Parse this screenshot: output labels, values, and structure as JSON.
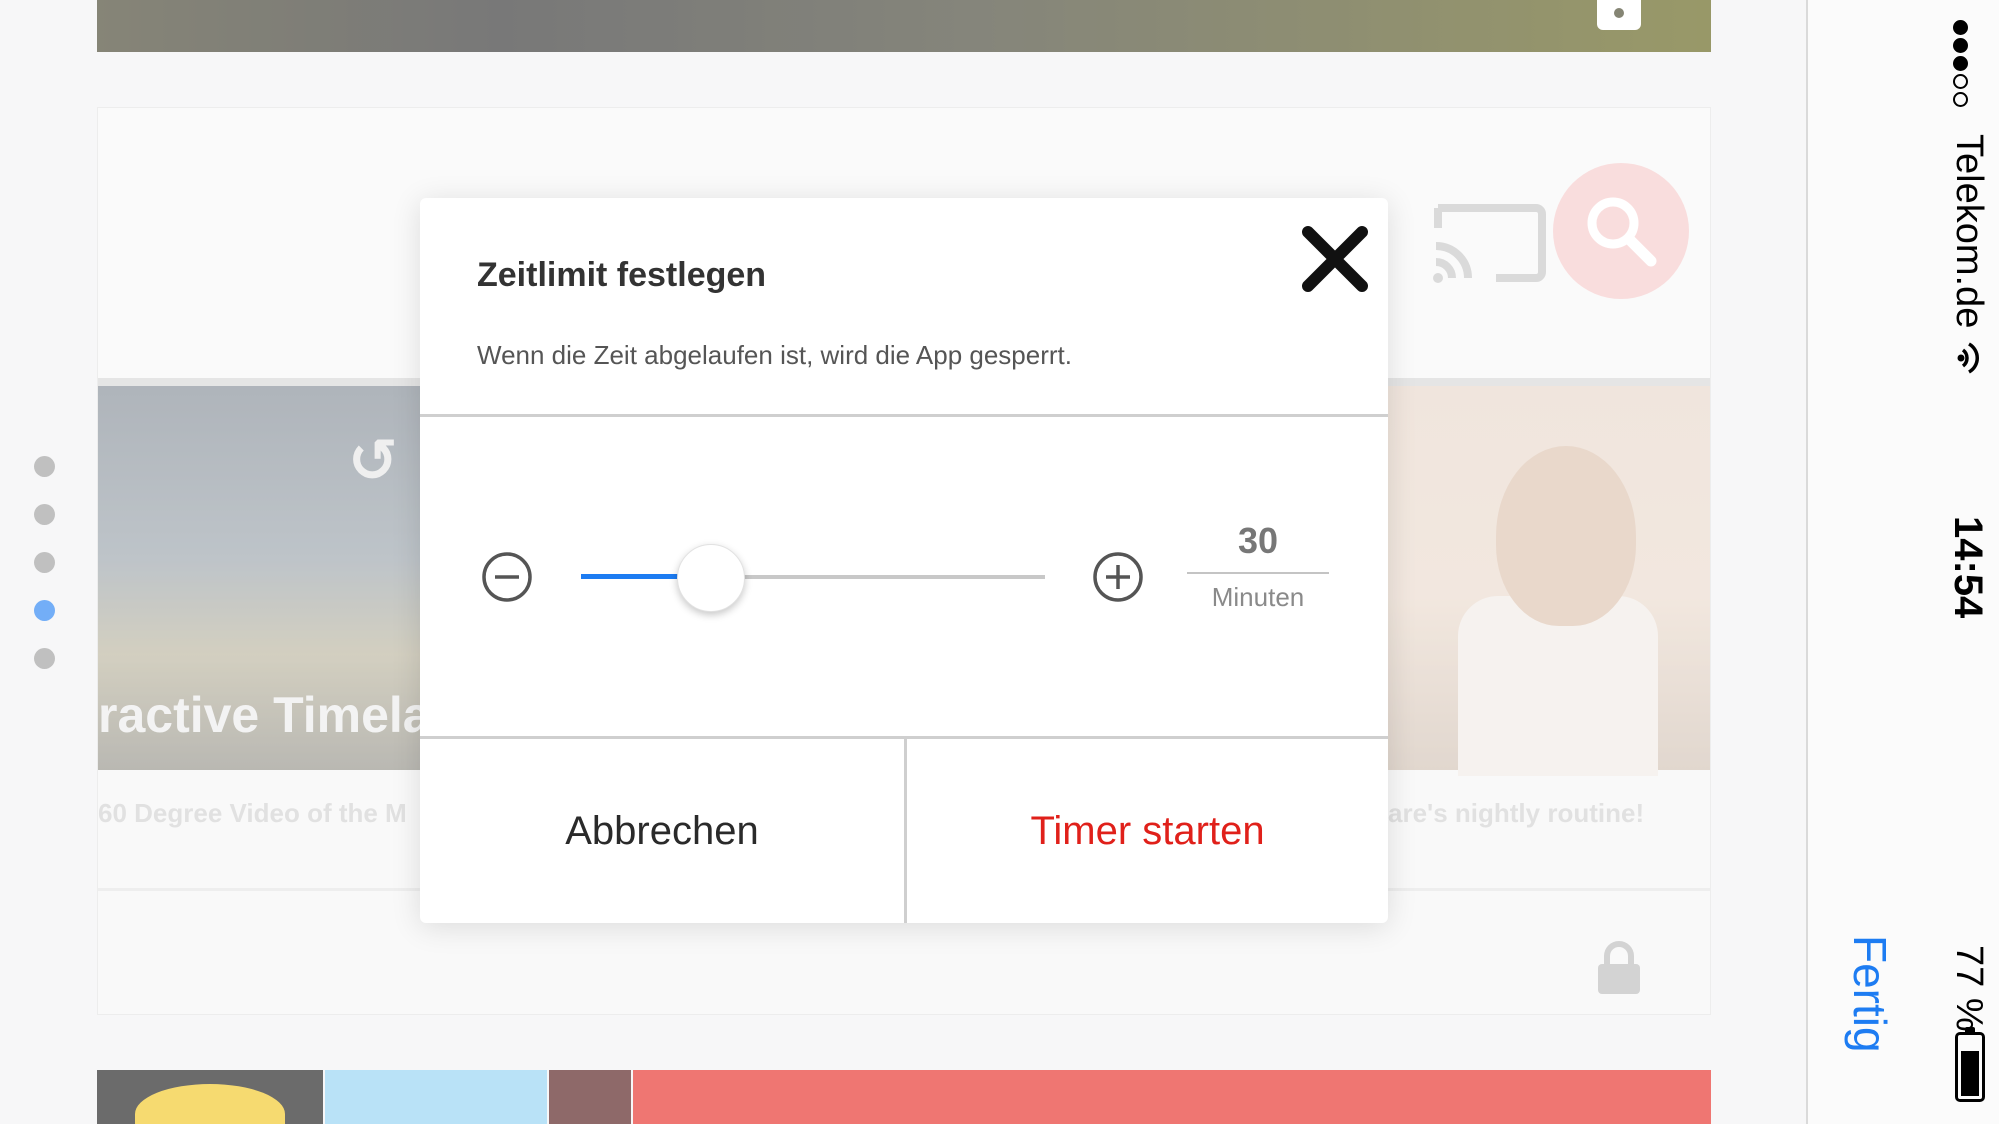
{
  "background": {
    "left_thumb_title": "ractive Timela",
    "left_thumb_caption": "60 Degree Video of the M",
    "right_thumb_caption": "are's nightly routine!",
    "page_dots": [
      false,
      false,
      false,
      true,
      false
    ]
  },
  "status_bar": {
    "carrier": "Telekom.de",
    "time": "14:54",
    "battery_percent": "77 %",
    "battery_level": 0.77,
    "signal_bars_filled": 3,
    "signal_bars_total": 5
  },
  "side": {
    "done_label": "Fertig"
  },
  "dialog": {
    "title": "Zeitlimit festlegen",
    "description": "Wenn die Zeit abgelaufen ist, wird die App gesperrt.",
    "slider": {
      "value": 30,
      "fraction": 0.28,
      "unit": "Minuten"
    },
    "cancel_label": "Abbrechen",
    "start_label": "Timer starten"
  },
  "colors": {
    "accent": "#1d7cf2",
    "danger": "#e0201a"
  },
  "icons": [
    "close-icon",
    "minus-circle-icon",
    "plus-circle-icon",
    "cast-icon",
    "search-icon",
    "lock-icon",
    "wifi-icon",
    "battery-icon",
    "replay-icon"
  ]
}
